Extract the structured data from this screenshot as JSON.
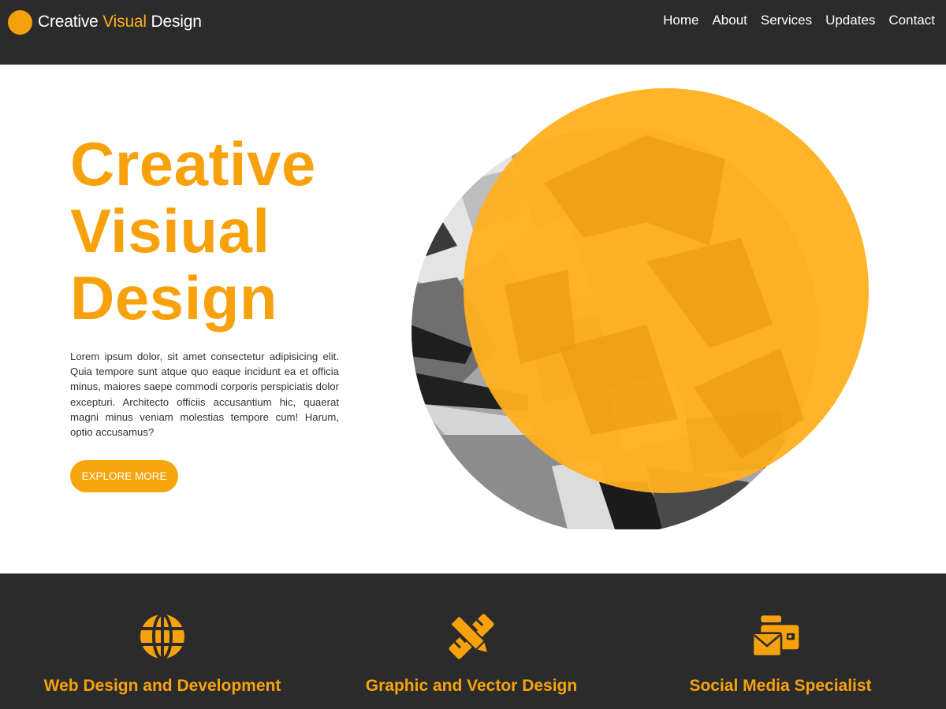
{
  "brand": {
    "name_part1": "Creative",
    "name_accent": "Visual",
    "name_part2": "Design"
  },
  "nav": {
    "items": [
      "Home",
      "About",
      "Services",
      "Updates",
      "Contact"
    ]
  },
  "hero": {
    "title_lines": [
      "Creative",
      "Visiual",
      "Design"
    ],
    "paragraph": "Lorem ipsum dolor, sit amet consectetur adipisicing elit. Quia tempore sunt atque quo eaque incidunt ea et officia minus, maiores saepe commodi corporis perspiciatis dolor excepturi. Architecto officiis accusantium hic, quaerat magni minus veniam molestias tempore cum! Harum, optio accusamus?",
    "button_label": "EXPLORE MORE",
    "image_icon": "graffiti-photo"
  },
  "services": [
    {
      "title": "Web Design and Development",
      "icon": "globe-icon"
    },
    {
      "title": "Graphic and Vector Design",
      "icon": "pencil-ruler-icon"
    },
    {
      "title": "Social Media Specialist",
      "icon": "envelope-wallet-icon"
    }
  ],
  "colors": {
    "accent": "#f7a20d",
    "dark": "#2b2b2b",
    "light": "#ffffff",
    "text": "#333333"
  }
}
